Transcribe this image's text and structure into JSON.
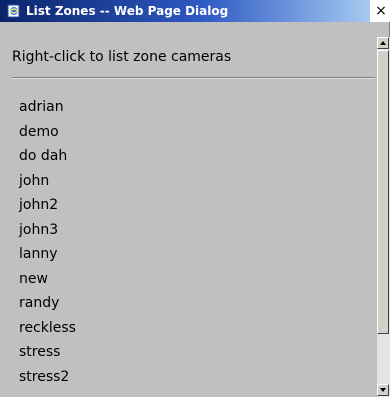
{
  "window": {
    "title": "List Zones -- Web Page Dialog",
    "close_glyph": "×"
  },
  "content": {
    "header": "Right-click to list zone cameras"
  },
  "zones": [
    "adrian",
    "demo",
    "do dah",
    "john",
    "john2",
    "john3",
    "lanny",
    "new",
    "randy",
    "reckless",
    "stress",
    "stress2"
  ],
  "colors": {
    "titlebar_start": "#0a246a",
    "titlebar_end": "#a6caf0",
    "dialog_bg": "#c0c0c0"
  },
  "icons": {
    "title": "ie-page-icon",
    "close": "close-icon"
  }
}
